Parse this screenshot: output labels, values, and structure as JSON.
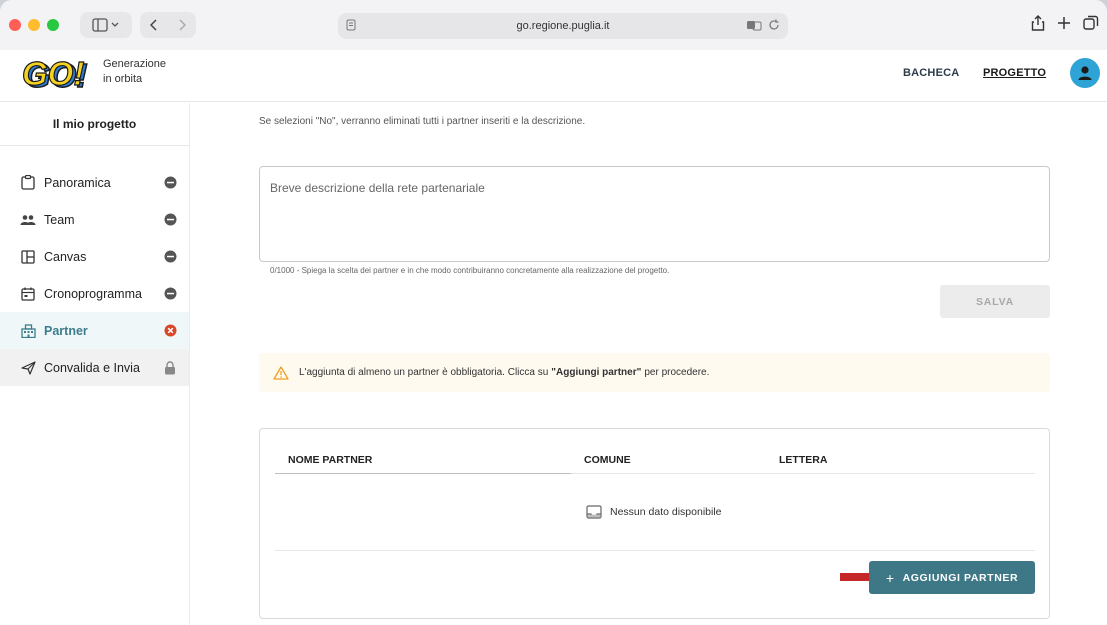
{
  "browser": {
    "url": "go.regione.puglia.it"
  },
  "header": {
    "logo_text": "GO!",
    "brand_line1": "Generazione",
    "brand_line2": "in orbita",
    "nav": [
      {
        "label": "BACHECA"
      },
      {
        "label": "PROGETTO"
      }
    ],
    "avatar_icon": "user-icon"
  },
  "sidebar": {
    "title": "Il mio progetto",
    "items": [
      {
        "label": "Panoramica",
        "icon": "clipboard-icon",
        "status": "minus-icon"
      },
      {
        "label": "Team",
        "icon": "people-icon",
        "status": "minus-icon"
      },
      {
        "label": "Canvas",
        "icon": "layout-icon",
        "status": "minus-icon"
      },
      {
        "label": "Cronoprogramma",
        "icon": "calendar-icon",
        "status": "minus-icon"
      },
      {
        "label": "Partner",
        "icon": "building-icon",
        "status": "error-icon"
      },
      {
        "label": "Convalida e Invia",
        "icon": "send-icon",
        "status": "lock-icon"
      }
    ]
  },
  "main": {
    "note_no": "Se selezioni \"No\", verranno eliminati tutti i partner inseriti e la descrizione.",
    "description_placeholder": "Breve descrizione della rete partenariale",
    "helper": "0/1000 - Spiega la scelta dei partner e in che modo contribuiranno concretamente alla realizzazione del progetto.",
    "save_label": "SALVA",
    "alert_before": "L'aggiunta di almeno un partner è obbligatoria. Clicca su",
    "alert_bold": "\"Aggiungi partner\"",
    "alert_after": "per procedere.",
    "table": {
      "columns": [
        "NOME PARTNER",
        "COMUNE",
        "LETTERA"
      ],
      "empty_text": "Nessun dato disponibile"
    },
    "add_partner_label": "AGGIUNGI PARTNER"
  },
  "colors": {
    "accent": "#3e7886",
    "avatar": "#2ea3d6",
    "error": "#d9472b",
    "arrow": "#c62828"
  }
}
